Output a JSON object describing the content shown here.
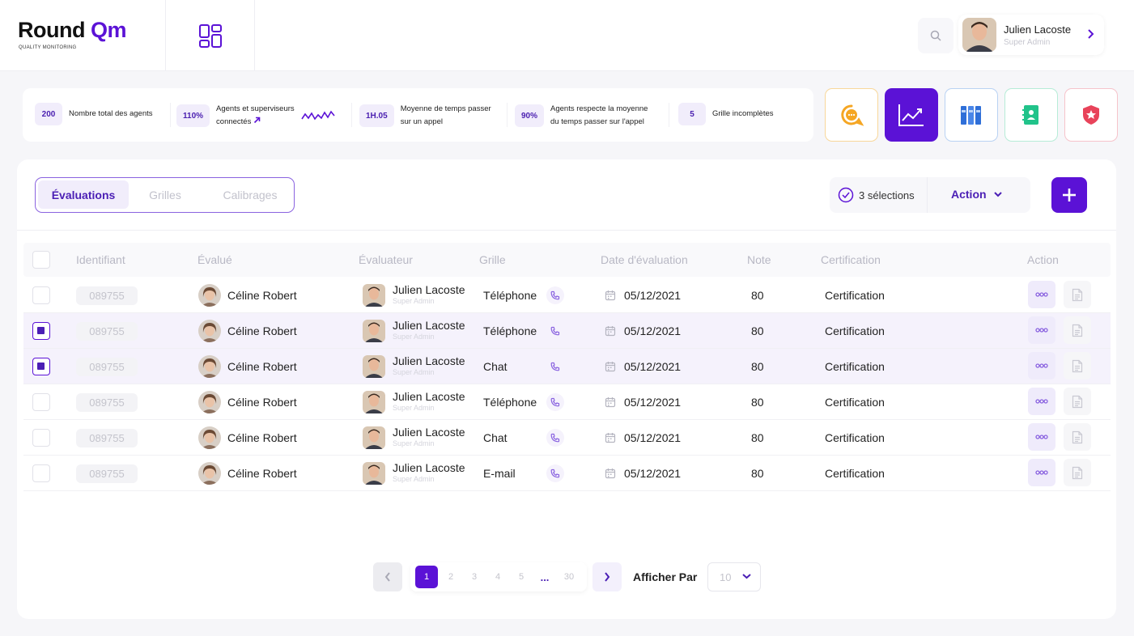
{
  "brand": {
    "logo_main": "Round ",
    "logo_accent": "Qm",
    "logo_sub": "QUALITY MONITORING"
  },
  "user": {
    "name": "Julien Lacoste",
    "role": "Super Admin"
  },
  "stats": [
    {
      "value": "200",
      "label": "Nombre total des agents"
    },
    {
      "value": "110%",
      "label": "Agents et superviseurs connectés"
    },
    {
      "value": "1H.05",
      "label": "Moyenne de temps passer sur un appel"
    },
    {
      "value": "90%",
      "label": "Agents respecte la moyenne du temps passer sur l'appel"
    },
    {
      "value": "5",
      "label": "Grille incomplètes"
    }
  ],
  "stat_labels_split": {
    "s0": "Nombre total des agents",
    "s1a": "Agents et superviseurs",
    "s1b": "connectés",
    "s2a": "Moyenne de temps passer",
    "s2b": "sur un appel",
    "s3a": "Agents respecte la moyenne",
    "s3b": "du temps passer sur l'appel",
    "s4": "Grille incomplètes"
  },
  "tiles": [
    {
      "icon": "chat-bubble-icon",
      "color": "#f5a623"
    },
    {
      "icon": "chart-trend-icon",
      "color": "#5b12d6"
    },
    {
      "icon": "binders-icon",
      "color": "#2f6fd8"
    },
    {
      "icon": "contact-book-icon",
      "color": "#21c38a"
    },
    {
      "icon": "shield-star-icon",
      "color": "#e8435a"
    }
  ],
  "tabs": {
    "t0": "Évaluations",
    "t1": "Grilles",
    "t2": "Calibrages"
  },
  "selection": {
    "count_label": "3 sélections",
    "action_label": "Action"
  },
  "table": {
    "headers": {
      "id": "Identifiant",
      "evalue": "Évalué",
      "evaluateur": "Évaluateur",
      "grille": "Grille",
      "date": "Date d'évaluation",
      "note": "Note",
      "certification": "Certification",
      "action": "Action"
    },
    "rows": [
      {
        "id": "089755",
        "evalue": "Céline Robert",
        "evaluateur": "Julien Lacoste",
        "role": "Super Admin",
        "grille": "Téléphone",
        "date": "05/12/2021",
        "note": "80",
        "certification": "Certification",
        "checked": false
      },
      {
        "id": "089755",
        "evalue": "Céline Robert",
        "evaluateur": "Julien Lacoste",
        "role": "Super Admin",
        "grille": "Téléphone",
        "date": "05/12/2021",
        "note": "80",
        "certification": "Certification",
        "checked": true
      },
      {
        "id": "089755",
        "evalue": "Céline Robert",
        "evaluateur": "Julien Lacoste",
        "role": "Super Admin",
        "grille": "Chat",
        "date": "05/12/2021",
        "note": "80",
        "certification": "Certification",
        "checked": true
      },
      {
        "id": "089755",
        "evalue": "Céline Robert",
        "evaluateur": "Julien Lacoste",
        "role": "Super Admin",
        "grille": "Téléphone",
        "date": "05/12/2021",
        "note": "80",
        "certification": "Certification",
        "checked": false
      },
      {
        "id": "089755",
        "evalue": "Céline Robert",
        "evaluateur": "Julien Lacoste",
        "role": "Super Admin",
        "grille": "Chat",
        "date": "05/12/2021",
        "note": "80",
        "certification": "Certification",
        "checked": false
      },
      {
        "id": "089755",
        "evalue": "Céline Robert",
        "evaluateur": "Julien Lacoste",
        "role": "Super Admin",
        "grille": "E-mail",
        "date": "05/12/2021",
        "note": "80",
        "certification": "Certification",
        "checked": false
      }
    ]
  },
  "pagination": {
    "pages": [
      "1",
      "2",
      "3",
      "4",
      "5",
      "...",
      "30"
    ],
    "current": "1",
    "per_page_label": "Afficher Par",
    "per_page_value": "10"
  }
}
